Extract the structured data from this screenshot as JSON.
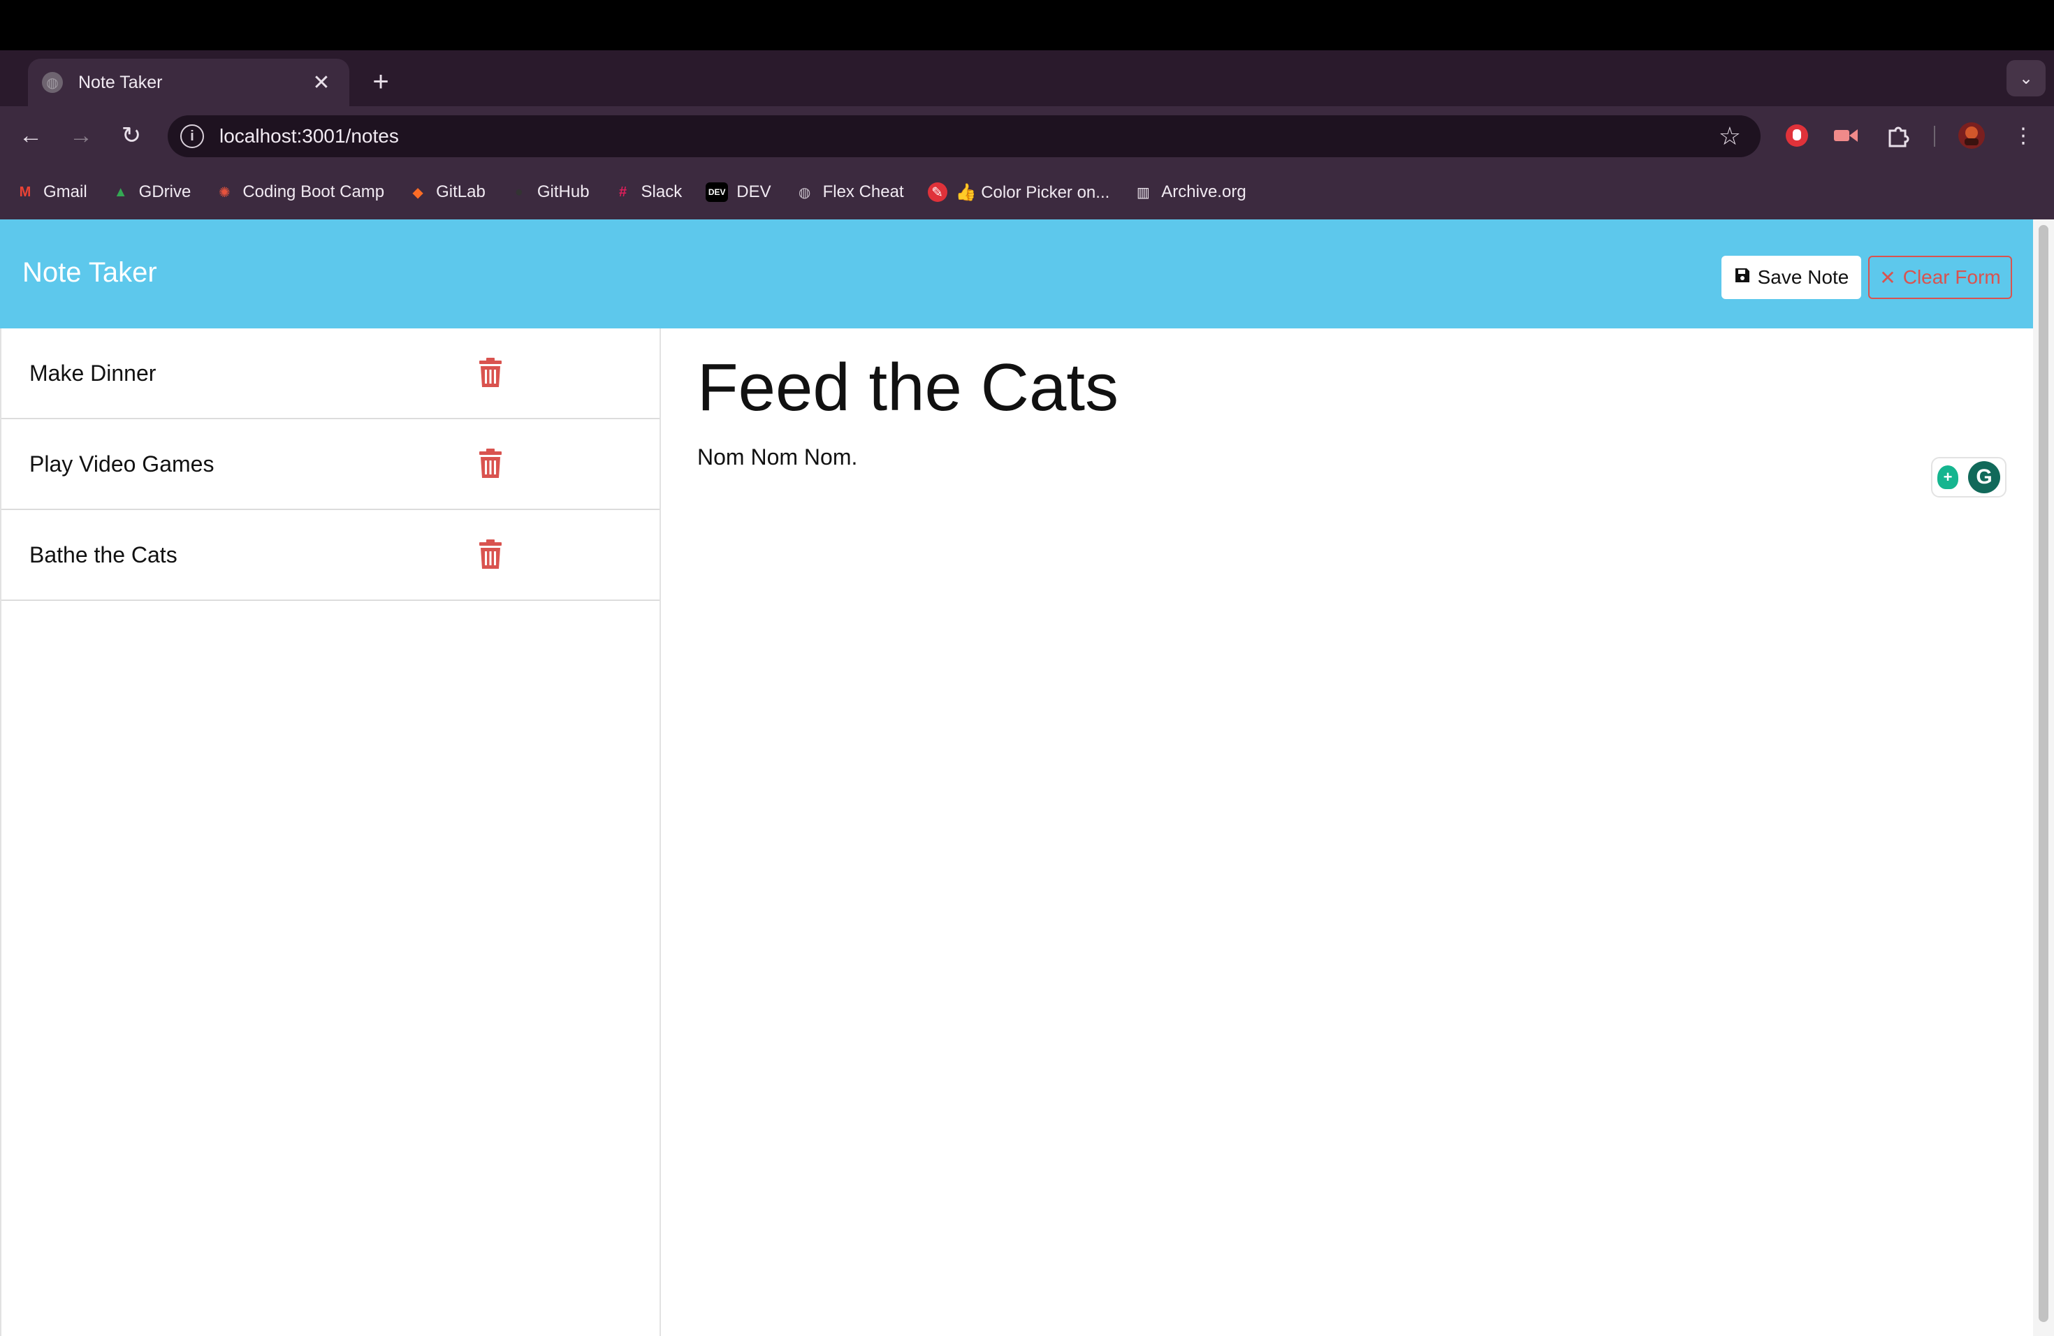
{
  "browser": {
    "tab_title": "Note Taker",
    "tab_close": "✕",
    "new_tab": "+",
    "url": "localhost:3001/notes",
    "bookmarks": [
      {
        "label": "Gmail",
        "icon": "gmail-icon",
        "glyph": "M",
        "color": "#ea4335"
      },
      {
        "label": "GDrive",
        "icon": "gdrive-icon",
        "glyph": "▲",
        "color": "#34a853"
      },
      {
        "label": "Coding Boot Camp",
        "icon": "bootcamp-icon",
        "glyph": "✺",
        "color": "#e5533d"
      },
      {
        "label": "GitLab",
        "icon": "gitlab-icon",
        "glyph": "◆",
        "color": "#fc6d26"
      },
      {
        "label": "GitHub",
        "icon": "github-icon",
        "glyph": "●",
        "color": "#333333"
      },
      {
        "label": "Slack",
        "icon": "slack-icon",
        "glyph": "#",
        "color": "#e01e5a"
      },
      {
        "label": "DEV",
        "icon": "dev-icon",
        "glyph": "DEV",
        "color": "#000000"
      },
      {
        "label": "Flex Cheat",
        "icon": "globe-icon",
        "glyph": "◍",
        "color": "#9a8f9c"
      },
      {
        "label": "👍 Color Picker on...",
        "icon": "color-picker-icon",
        "glyph": "✎",
        "color": "#e0323a"
      },
      {
        "label": "Archive.org",
        "icon": "archive-icon",
        "glyph": "▥",
        "color": "#f1eaf2"
      }
    ]
  },
  "app": {
    "brand": "Note Taker",
    "save_label": "Save Note",
    "clear_label": "Clear Form",
    "notes": [
      {
        "title": "Make Dinner"
      },
      {
        "title": "Play Video Games"
      },
      {
        "title": "Bathe the Cats"
      }
    ],
    "active_note": {
      "title": "Feed the Cats",
      "text": "Nom Nom Nom."
    },
    "colors": {
      "navbar": "#5dc8ec",
      "danger": "#d9534f"
    }
  }
}
